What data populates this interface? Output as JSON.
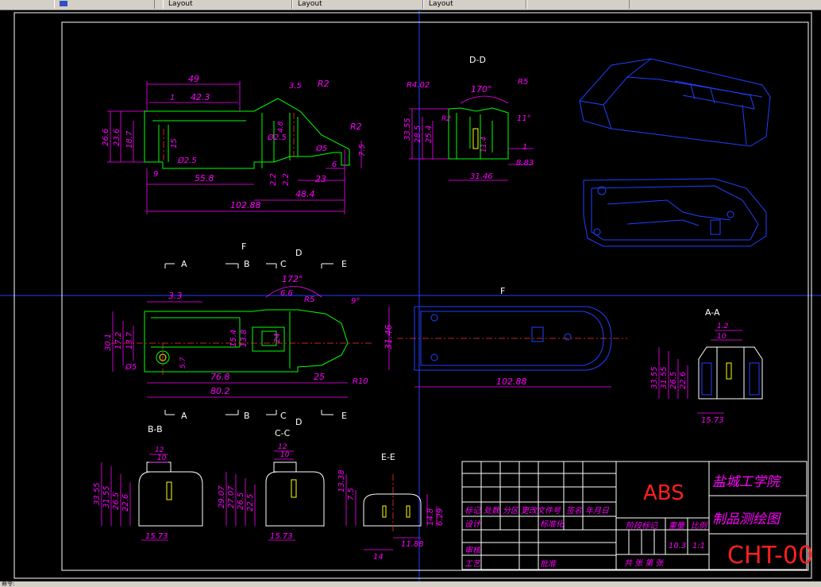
{
  "tabs": [
    {
      "label": ""
    },
    {
      "label": "Layout"
    },
    {
      "label": "Layout"
    },
    {
      "label": "Layout"
    },
    {
      "label": ""
    }
  ],
  "status": {
    "text": "命令:"
  },
  "views": {
    "dd": "D-D",
    "f": "F",
    "f_top": "F",
    "aa": "A-A",
    "bb": "B-B",
    "cc": "C-C",
    "ee": "E-E"
  },
  "section_markers": {
    "a": "A",
    "b": "B",
    "c": "C",
    "d": "D",
    "e": "E"
  },
  "dims_front": [
    "49",
    "42.3",
    "1",
    "3.5",
    "R2",
    "R2",
    "26.6",
    "23.6",
    "18.7",
    "15",
    "Ø2.5",
    "9",
    "55.8",
    "Ø2.5",
    "Ø5",
    "7.5",
    "6",
    "2.2",
    "23",
    "48.4",
    "102.88",
    "2.2",
    "4.8"
  ],
  "dims_dd": [
    "R4.02",
    "170°",
    "R5",
    "R2",
    "33.55",
    "28.5",
    "25.4",
    "11°",
    "11.4",
    "1",
    "8.83",
    "31.46"
  ],
  "dims_plan": [
    "3.3",
    "172°",
    "6.6",
    "R5",
    "9°",
    "30.1",
    "17.2",
    "13.7",
    "15.4",
    "13.8",
    "24",
    "Ø5",
    "5.7",
    "76.8",
    "25",
    "80.2",
    "R10"
  ],
  "dims_f": [
    "31.46",
    "102.88"
  ],
  "dims_aa": [
    "1.2",
    "10",
    "33.55",
    "31.55",
    "26.5",
    "22.6",
    "15.73"
  ],
  "dims_bb": [
    "12",
    "10",
    "33.55",
    "31.55",
    "26.5",
    "22.6",
    "15.73"
  ],
  "dims_cc": [
    "12",
    "10",
    "29.07",
    "27.07",
    "26.5",
    "22.5",
    "15.73"
  ],
  "dims_ee": [
    "13.38",
    "7.5",
    "14.8",
    "6.29",
    "14",
    "11.88"
  ],
  "title_block": {
    "school": "盐城工学院",
    "drawing_name": "制品测绘图",
    "material": "ABS",
    "code": "CHT-00",
    "row_headers": [
      "标记",
      "处数",
      "分区",
      "更改文件号",
      "签名",
      "年月日"
    ],
    "design": "设计",
    "standard": "标准化",
    "stage_mark": "阶段标记",
    "weight": "重量",
    "scale": "比例",
    "weight_value": "10.3",
    "scale_value": "1:1",
    "review": "审核",
    "process": "工艺",
    "approve": "批准",
    "sheets": "共    张    第    张"
  }
}
